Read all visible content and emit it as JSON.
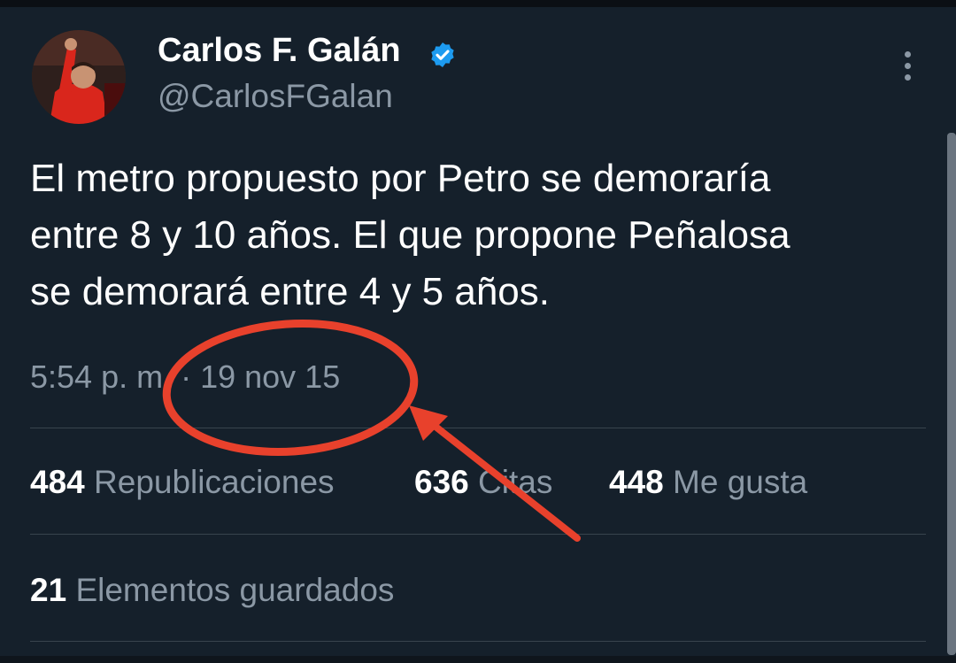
{
  "author": {
    "name": "Carlos F. Galán",
    "handle": "@CarlosFGalan",
    "verified_color": "#1d9bf0"
  },
  "tweet": {
    "lines": [
      "El metro propuesto por Petro se demoraría",
      "entre 8 y 10 años. El que propone Peñalosa",
      "se demorará entre 4 y 5 años."
    ],
    "timestamp": "5:54 p. m. · 19 nov 15"
  },
  "stats": {
    "reposts": {
      "count": "484",
      "label": "Republicaciones"
    },
    "quotes": {
      "count": "636",
      "label": "Citas"
    },
    "likes": {
      "count": "448",
      "label": "Me gusta"
    },
    "bookmarks": {
      "count": "21",
      "label": "Elementos guardados"
    }
  },
  "icons": {
    "verified": "verified-badge-icon",
    "more": "more-options-icon"
  },
  "colors": {
    "background": "#15202b",
    "annotation": "#e8412c",
    "secondary_text": "#8b98a5"
  }
}
